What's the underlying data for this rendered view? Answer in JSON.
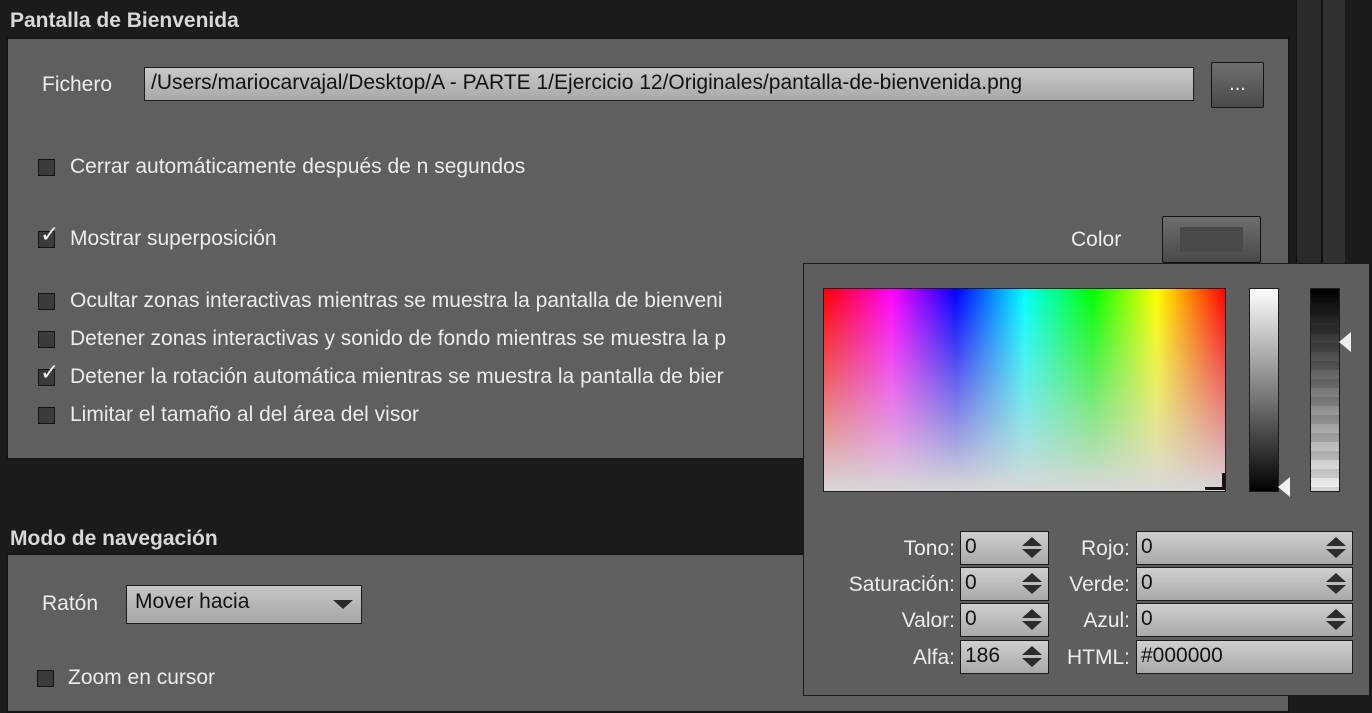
{
  "welcome": {
    "title": "Pantalla de Bienvenida",
    "file_label": "Fichero",
    "file_path": "/Users/mariocarvajal/Desktop/A - PARTE 1/Ejercicio 12/Originales/pantalla-de-bienvenida.png",
    "browse_label": "...",
    "color_label": "Color",
    "swatch_color": "#4a4a4a",
    "options": [
      {
        "label": "Cerrar automáticamente después de n segundos",
        "checked": false
      },
      {
        "label": "Mostrar superposición",
        "checked": true
      },
      {
        "label": "Ocultar zonas interactivas mientras se muestra la pantalla de bienveni",
        "checked": false
      },
      {
        "label": "Detener zonas interactivas y sonido de fondo mientras se muestra la p",
        "checked": false
      },
      {
        "label": "Detener la rotación automática mientras se muestra la pantalla de bier",
        "checked": true
      },
      {
        "label": "Limitar el tamaño al del área del visor",
        "checked": false
      }
    ]
  },
  "navigation": {
    "title": "Modo de navegación",
    "mouse_label": "Ratón",
    "mouse_value": "Mover hacia",
    "zoom_label": "Zoom en cursor",
    "zoom_checked": false
  },
  "color_picker": {
    "fields": {
      "tono": {
        "label": "Tono:",
        "value": "0"
      },
      "saturacion": {
        "label": "Saturación:",
        "value": "0"
      },
      "valor": {
        "label": "Valor:",
        "value": "0"
      },
      "alfa": {
        "label": "Alfa:",
        "value": "186"
      },
      "rojo": {
        "label": "Rojo:",
        "value": "0"
      },
      "verde": {
        "label": "Verde:",
        "value": "0"
      },
      "azul": {
        "label": "Azul:",
        "value": "0"
      },
      "html": {
        "label": "HTML:",
        "value": "#000000"
      }
    }
  }
}
